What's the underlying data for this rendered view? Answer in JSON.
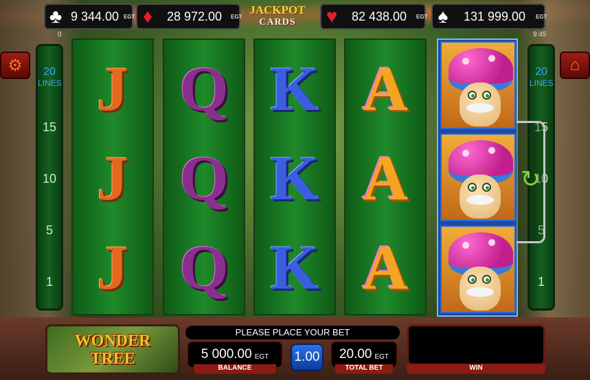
{
  "jackpots": [
    {
      "suit": "clubs-icon",
      "glyph": "♣",
      "color": "#ffffff",
      "amount": "9 344.00",
      "brand": "EGT"
    },
    {
      "suit": "diamonds-icon",
      "glyph": "♦",
      "color": "#e3202a",
      "amount": "28 972.00",
      "brand": "EGT"
    },
    {
      "suit": "hearts-icon",
      "glyph": "♥",
      "color": "#e3202a",
      "amount": "82 438.00",
      "brand": "EGT"
    },
    {
      "suit": "spades-icon",
      "glyph": "♠",
      "color": "#ffffff",
      "amount": "131 999.00",
      "brand": "EGT"
    }
  ],
  "jackpot_logo": {
    "line1": "JACKPOT",
    "line2": "CARDS"
  },
  "counter_left": "0",
  "clock": "9:45",
  "lines": {
    "count": "20",
    "label": "LINES",
    "marks": [
      "15",
      "10",
      "5",
      "1"
    ]
  },
  "reels": [
    [
      "J",
      "J",
      "J"
    ],
    [
      "Q",
      "Q",
      "Q"
    ],
    [
      "K",
      "K",
      "K"
    ],
    [
      "A",
      "A",
      "A"
    ],
    [
      "mushroom-wild",
      "mushroom-wild",
      "mushroom-wild"
    ]
  ],
  "game_logo": {
    "line1": "WONDER",
    "line2": "TREE"
  },
  "message": "PLEASE PLACE YOUR BET",
  "balance": {
    "value": "5 000.00",
    "currency": "EGT",
    "label": "BALANCE"
  },
  "denomination": "1.00",
  "total_bet": {
    "value": "20.00",
    "currency": "EGT",
    "label": "TOTAL BET"
  },
  "win": {
    "value": "",
    "label": "WIN"
  },
  "colors": {
    "accent_red": "#8a1c12",
    "reel_green": "#1f8a2a",
    "line_blue": "#35a6ff"
  }
}
